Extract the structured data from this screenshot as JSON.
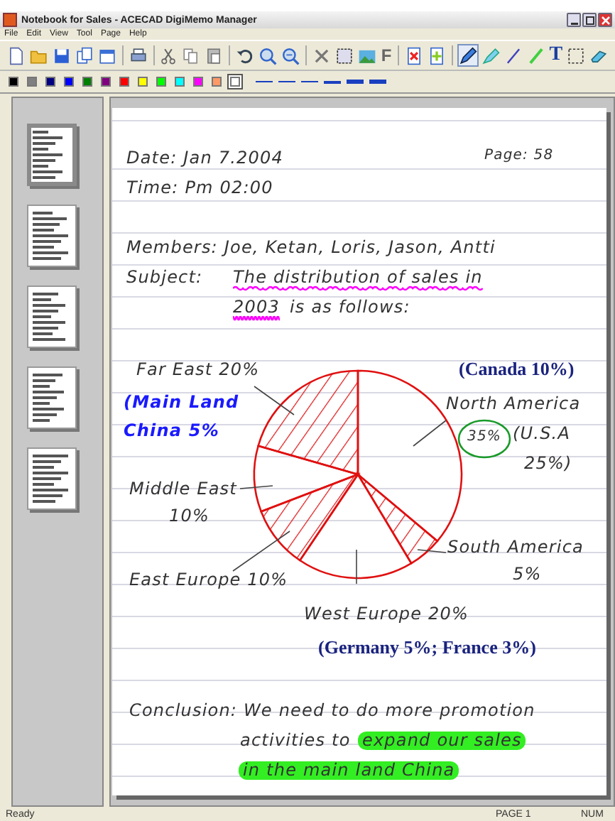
{
  "window": {
    "title": "Notebook for Sales - ACECAD DigiMemo Manager"
  },
  "menu": [
    "File",
    "Edit",
    "View",
    "Tool",
    "Page",
    "Help"
  ],
  "font_button": {
    "label": "F"
  },
  "tools": [
    {
      "kind": "pen",
      "selected": true
    },
    {
      "kind": "highlighter",
      "selected": false
    },
    {
      "kind": "line",
      "selected": false
    },
    {
      "kind": "marker",
      "selected": false
    },
    {
      "kind": "text",
      "label": "T",
      "selected": false
    },
    {
      "kind": "select",
      "selected": false
    },
    {
      "kind": "eraser",
      "selected": false
    }
  ],
  "palette": [
    {
      "color": "#000000",
      "selected": false
    },
    {
      "color": "#808080",
      "selected": false
    },
    {
      "color": "#000080",
      "selected": false
    },
    {
      "color": "#0000ff",
      "selected": false
    },
    {
      "color": "#008000",
      "selected": false
    },
    {
      "color": "#800080",
      "selected": false
    },
    {
      "color": "#ff0000",
      "selected": false
    },
    {
      "color": "#ffff00",
      "selected": false
    },
    {
      "color": "#00ff00",
      "selected": false
    },
    {
      "color": "#00ffff",
      "selected": false
    },
    {
      "color": "#ff00ff",
      "selected": false
    },
    {
      "color": "#ff9966",
      "selected": false
    },
    {
      "color": "#ffffff",
      "selected": true
    }
  ],
  "thumbnails": [
    {
      "selected": true
    },
    {
      "selected": false
    },
    {
      "selected": false
    },
    {
      "selected": false
    },
    {
      "selected": false
    }
  ],
  "notes": [
    {
      "kind": "handwriting",
      "text": "Date: Jan 7.2004",
      "color": "#333333"
    },
    {
      "kind": "handwriting",
      "text": "Page: 58",
      "color": "#333333"
    },
    {
      "kind": "handwriting",
      "text": "Time: Pm 02:00",
      "color": "#333333"
    },
    {
      "kind": "handwriting",
      "text": "Members: Joe, Ketan, Loris, Jason, Antti",
      "color": "#333333"
    },
    {
      "kind": "handwriting",
      "text": "Subject:",
      "color": "#333333"
    },
    {
      "kind": "handwriting",
      "text": "The distribution of sales in",
      "color": "#333333",
      "underline": {
        "color": "#ff00ff"
      }
    },
    {
      "kind": "handwriting",
      "text": "2003",
      "color": "#333333",
      "underline": {
        "color": "#ff00ff"
      }
    },
    {
      "kind": "handwriting",
      "text": "is as follows:",
      "color": "#333333"
    },
    {
      "kind": "handwriting",
      "text": "Far East 20%",
      "color": "#333333"
    },
    {
      "kind": "typed",
      "text": "(Canada 10%)",
      "color": "#1a237e"
    },
    {
      "kind": "handwriting",
      "text": "(Main Land",
      "color": "#1a1aff"
    },
    {
      "kind": "handwriting",
      "text": "China 5%",
      "color": "#1a1aff"
    },
    {
      "kind": "handwriting",
      "text": "North America",
      "color": "#333333"
    },
    {
      "kind": "handwriting",
      "text": "35%",
      "color": "#333333"
    },
    {
      "kind": "handwriting",
      "text": "(U.S.A",
      "color": "#333333"
    },
    {
      "kind": "handwriting",
      "text": "25%)",
      "color": "#333333"
    },
    {
      "kind": "handwriting",
      "text": "Middle East",
      "color": "#333333"
    },
    {
      "kind": "handwriting",
      "text": "10%",
      "color": "#333333"
    },
    {
      "kind": "handwriting",
      "text": "South America",
      "color": "#333333"
    },
    {
      "kind": "handwriting",
      "text": "5%",
      "color": "#333333"
    },
    {
      "kind": "handwriting",
      "text": "East Europe 10%",
      "color": "#333333"
    },
    {
      "kind": "handwriting",
      "text": "West Europe 20%",
      "color": "#333333"
    },
    {
      "kind": "typed",
      "text": "(Germany 5%; France 3%)",
      "color": "#1a237e"
    },
    {
      "kind": "handwriting",
      "text": "Conclusion: We need to do more promotion",
      "color": "#333333"
    },
    {
      "kind": "handwriting",
      "text": "activities to",
      "color": "#333333"
    },
    {
      "kind": "handwriting",
      "text": "expand our sales",
      "highlight": {
        "color": "#33ee22"
      }
    },
    {
      "kind": "handwriting",
      "text": "in the main land China",
      "highlight": {
        "color": "#33ee22"
      }
    }
  ],
  "status_bar": {
    "text": "Ready",
    "page": "PAGE 1",
    "num": "NUM"
  }
}
